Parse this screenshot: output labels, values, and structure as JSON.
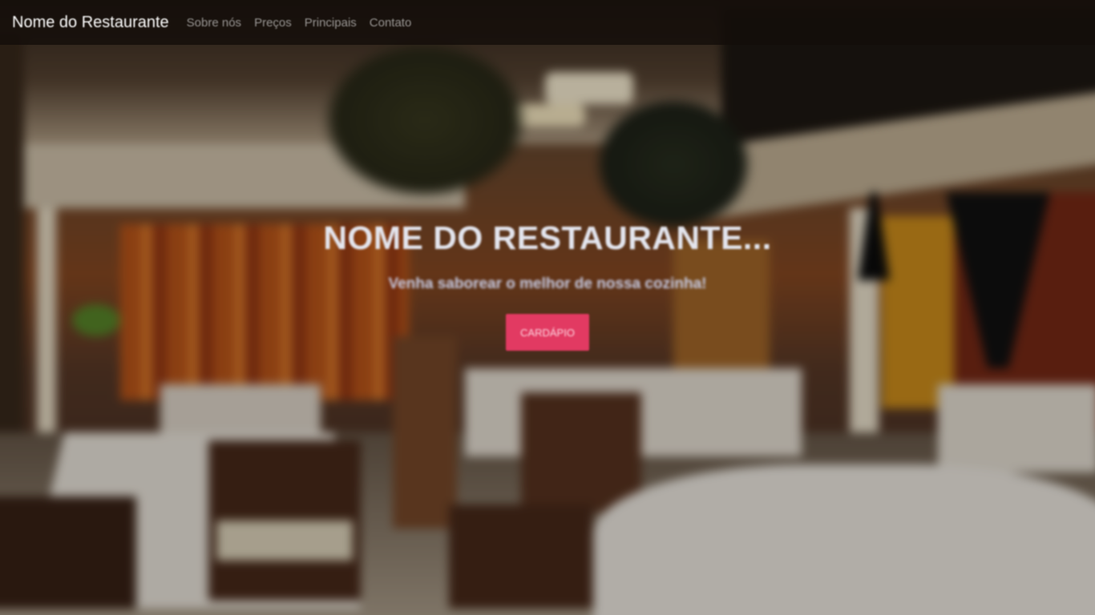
{
  "navbar": {
    "brand": "Nome do Restaurante",
    "links": [
      "Sobre nós",
      "Preços",
      "Principais",
      "Contato"
    ]
  },
  "hero": {
    "title": "NOME DO RESTAURANTE...",
    "subtitle": "Venha saborear o melhor de nossa cozinha!",
    "button_label": "CARDÁPIO"
  },
  "colors": {
    "navbar_bg": "#140e0a",
    "accent_button": "#e23a62",
    "hero_title": "#e4e6ef"
  },
  "background": {
    "description_icon": "restaurant-interior-photo"
  }
}
